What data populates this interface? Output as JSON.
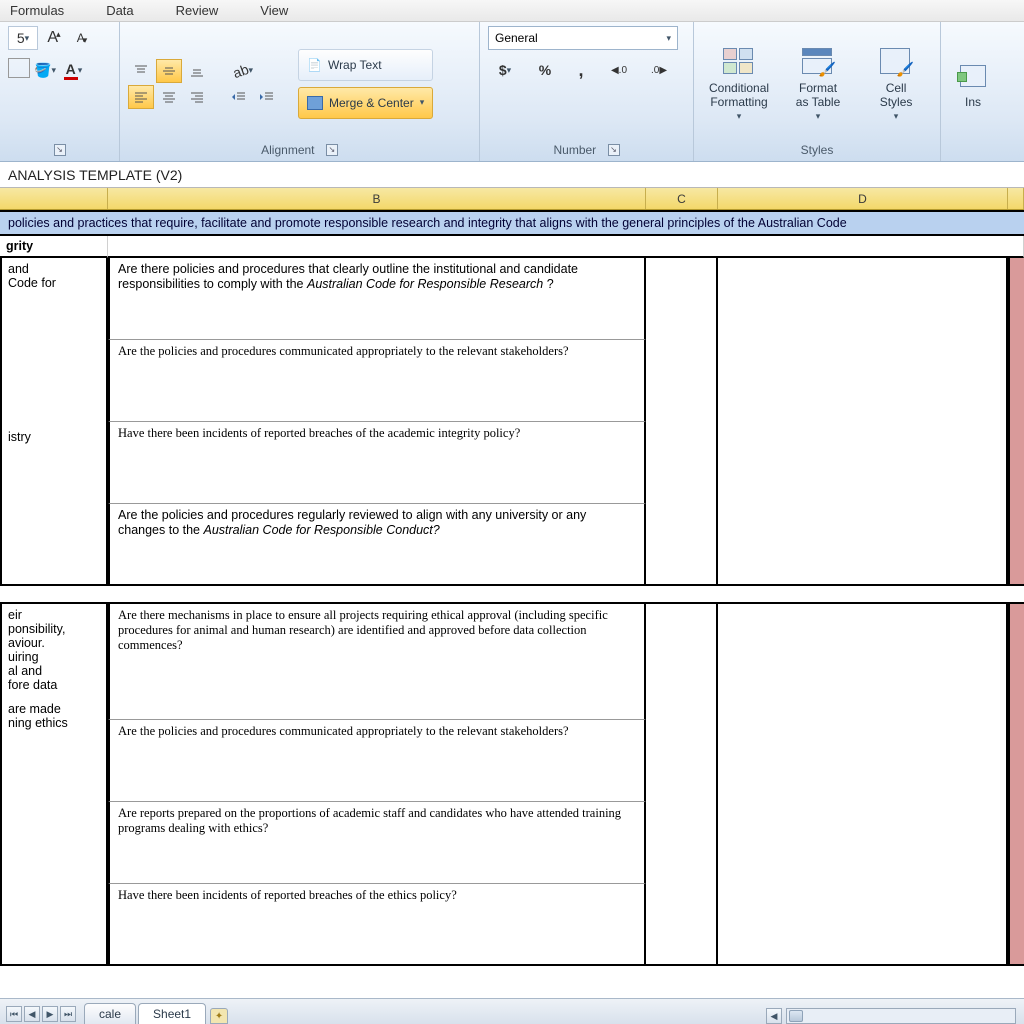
{
  "menu": {
    "formulas": "Formulas",
    "data": "Data",
    "review": "Review",
    "view": "View"
  },
  "ribbon": {
    "font": {
      "increase": "A",
      "decrease": "A",
      "clear_fill": "◇"
    },
    "alignment": {
      "label": "Alignment",
      "wrap": "Wrap Text",
      "merge": "Merge & Center"
    },
    "number": {
      "label": "Number",
      "format": "General",
      "currency": "$",
      "percent": "%",
      "comma": ",",
      "inc_dec": "⁰₀",
      "dec_dec": "⁰₀"
    },
    "styles": {
      "label": "Styles",
      "conditional": "Conditional\nFormatting",
      "table": "Format\nas Table",
      "cell": "Cell\nStyles"
    },
    "cells": {
      "insert": "Ins"
    }
  },
  "formula_bar": "ANALYSIS TEMPLATE (V2)",
  "columns": {
    "B": "B",
    "C": "C",
    "D": "D"
  },
  "blue_row": "policies and practices that require, facilitate and promote responsible research and integrity that aligns with the general principles of the Australian Code",
  "section_header": "grity",
  "colA": {
    "block1_line1": "and",
    "block1_line2": "Code for",
    "block1_line3": "istry",
    "block2_line1": "eir",
    "block2_line2": "ponsibility,",
    "block2_line3": "aviour.",
    "block2_line4": "uiring",
    "block2_line5": "al and",
    "block2_line6": "fore data",
    "block2_line7": "are made",
    "block2_line8": "ning ethics"
  },
  "questions": {
    "b1q1a": "Are there policies and procedures that clearly outline the institutional and candidate responsibilities to comply with the ",
    "b1q1b": "Australian Code for Responsible Research",
    "b1q1c": " ?",
    "b1q2": "Are the policies and procedures communicated appropriately to the relevant stakeholders?",
    "b1q3": "Have there been incidents of reported breaches of the academic integrity policy?",
    "b1q4a": "Are the policies and procedures regularly reviewed to align with any university or any changes to the ",
    "b1q4b": "Australian Code for Responsible Conduct?",
    "b2q1": "Are there mechanisms in place to ensure all projects requiring ethical approval (including specific procedures for animal and human research) are identified and approved before data collection commences?",
    "b2q2": "Are the policies and procedures communicated appropriately to the relevant stakeholders?",
    "b2q3": "Are reports prepared on the proportions of academic staff and candidates who have attended training programs dealing with ethics?",
    "b2q4": "Have there been incidents of reported breaches of the ethics policy?"
  },
  "tabs": {
    "t1": "cale",
    "t2": "Sheet1"
  }
}
